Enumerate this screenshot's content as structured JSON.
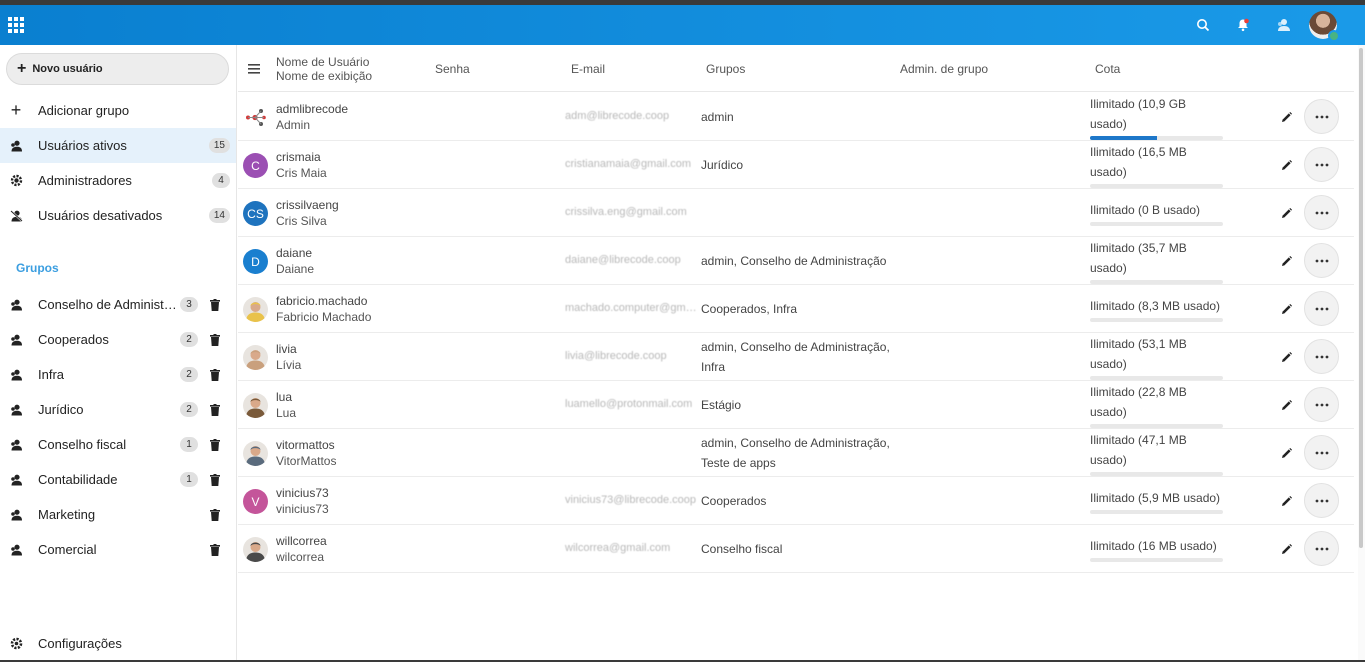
{
  "header": {
    "icons": [
      "apps-grid-icon",
      "search-icon",
      "notifications-icon",
      "contacts-icon",
      "user-avatar"
    ],
    "accent": "#0a7fd0"
  },
  "sidebar": {
    "new_user_label": "Novo usuário",
    "items": [
      {
        "label": "Adicionar grupo",
        "icon": "plus-icon",
        "count": ""
      },
      {
        "label": "Usuários ativos",
        "icon": "users-icon",
        "count": "15"
      },
      {
        "label": "Administradores",
        "icon": "admin-gear-icon",
        "count": "4"
      },
      {
        "label": "Usuários desativados",
        "icon": "disabled-users-icon",
        "count": "14"
      }
    ],
    "groups_caption": "Grupos",
    "groups": [
      {
        "label": "Conselho de Administração",
        "count": "3"
      },
      {
        "label": "Cooperados",
        "count": "2"
      },
      {
        "label": "Infra",
        "count": "2"
      },
      {
        "label": "Jurídico",
        "count": "2"
      },
      {
        "label": "Conselho fiscal",
        "count": "1"
      },
      {
        "label": "Contabilidade",
        "count": "1"
      },
      {
        "label": "Marketing",
        "count": ""
      },
      {
        "label": "Comercial",
        "count": ""
      }
    ],
    "settings_label": "Configurações"
  },
  "table": {
    "headers": {
      "username": "Nome de Usuário",
      "displayname": "Nome de exibição",
      "password": "Senha",
      "email": "E-mail",
      "groups": "Grupos",
      "subadmin": "Admin. de grupo",
      "quota": "Cota"
    },
    "rows": [
      {
        "username": "admlibrecode",
        "display": "Admin",
        "initials": "",
        "avatar_color": "#ffffff",
        "email": "adm@librecode.coop",
        "groups": "admin",
        "quota": "Ilimitado (10,9 GB usado)",
        "usage": 0.5
      },
      {
        "username": "crismaia",
        "display": "Cris Maia",
        "initials": "C",
        "avatar_color": "#9b4fb3",
        "email": "cristianamaia@gmail.com",
        "groups": "Jurídico",
        "quota": "Ilimitado (16,5 MB usado)",
        "usage": 0.0
      },
      {
        "username": "crissilvaeng",
        "display": "Cris Silva",
        "initials": "CS",
        "avatar_color": "#1e73be",
        "email": "crissilva.eng@gmail.com",
        "groups": "",
        "quota": "Ilimitado (0 B usado)",
        "usage": 0.0
      },
      {
        "username": "daiane",
        "display": "Daiane",
        "initials": "D",
        "avatar_color": "#1a7fcf",
        "email": "daiane@librecode.coop",
        "groups": "admin, Conselho de Administração",
        "quota": "Ilimitado (35,7 MB usado)",
        "usage": 0.0
      },
      {
        "username": "fabricio.machado",
        "display": "Fabricio Machado",
        "initials": "",
        "avatar_color": "#e9c24a",
        "email": "machado.computer@gmail.com",
        "groups": "Cooperados, Infra",
        "quota": "Ilimitado (8,3 MB usado)",
        "usage": 0.0
      },
      {
        "username": "livia",
        "display": "Lívia",
        "initials": "",
        "avatar_color": "#c9a07d",
        "email": "livia@librecode.coop",
        "groups": "admin, Conselho de Administração, Infra",
        "quota": "Ilimitado (53,1 MB usado)",
        "usage": 0.0
      },
      {
        "username": "lua",
        "display": "Lua",
        "initials": "",
        "avatar_color": "#7a5a3a",
        "email": "luamello@protonmail.com",
        "groups": "Estágio",
        "quota": "Ilimitado (22,8 MB usado)",
        "usage": 0.0
      },
      {
        "username": "vitormattos",
        "display": "VitorMattos",
        "initials": "",
        "avatar_color": "#5a6b7d",
        "email": "",
        "groups": "admin, Conselho de Administração, Teste de apps",
        "quota": "Ilimitado (47,1 MB usado)",
        "usage": 0.0
      },
      {
        "username": "vinicius73",
        "display": "vinicius73",
        "initials": "V",
        "avatar_color": "#c4559a",
        "email": "vinicius73@librecode.coop",
        "groups": "Cooperados",
        "quota": "Ilimitado (5,9 MB usado)",
        "usage": 0.0
      },
      {
        "username": "willcorrea",
        "display": "wilcorrea",
        "initials": "",
        "avatar_color": "#4a4a4a",
        "email": "wilcorrea@gmail.com",
        "groups": "Conselho fiscal",
        "quota": "Ilimitado (16 MB usado)",
        "usage": 0.0
      }
    ]
  }
}
